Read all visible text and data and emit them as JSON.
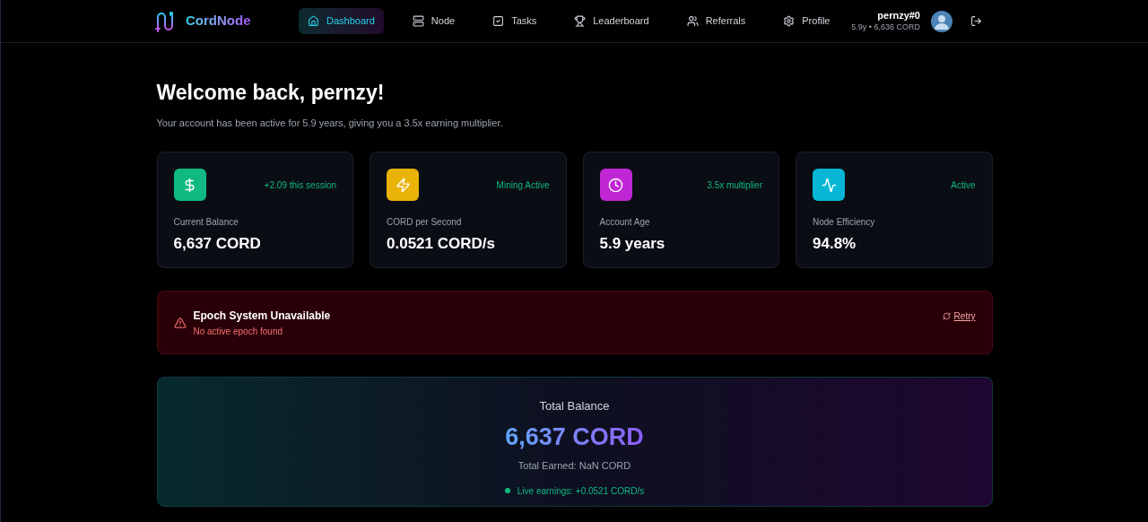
{
  "brand": "CordNode",
  "nav": [
    {
      "label": "Dashboard",
      "selected": true
    },
    {
      "label": "Node",
      "selected": false
    },
    {
      "label": "Tasks",
      "selected": false
    },
    {
      "label": "Leaderboard",
      "selected": false
    },
    {
      "label": "Referrals",
      "selected": false
    },
    {
      "label": "Profile",
      "selected": false
    }
  ],
  "user": {
    "name": "pernzy#0",
    "meta": "5.9y • 6,636 CORD"
  },
  "welcome": {
    "title": "Welcome back, pernzy!",
    "subtitle": "Your account has been active for 5.9 years, giving you a 3.5x earning multiplier."
  },
  "stats": [
    {
      "label": "Current Balance",
      "value": "6,637 CORD",
      "note": "+2.09 this session",
      "color": "#10b981"
    },
    {
      "label": "CORD per Second",
      "value": "0.0521 CORD/s",
      "note": "Mining Active",
      "color": "#eab308"
    },
    {
      "label": "Account Age",
      "value": "5.9 years",
      "note": "3.5x multiplier",
      "color": "#c026d3"
    },
    {
      "label": "Node Efficiency",
      "value": "94.8%",
      "note": "Active",
      "color": "#06b6d4"
    }
  ],
  "alert": {
    "title": "Epoch System Unavailable",
    "message": "No active epoch found",
    "action": "Retry"
  },
  "total": {
    "title": "Total Balance",
    "value": "6,637 CORD",
    "earned": "Total Earned: NaN CORD",
    "live": "Live earnings: +0.0521 CORD/s"
  }
}
